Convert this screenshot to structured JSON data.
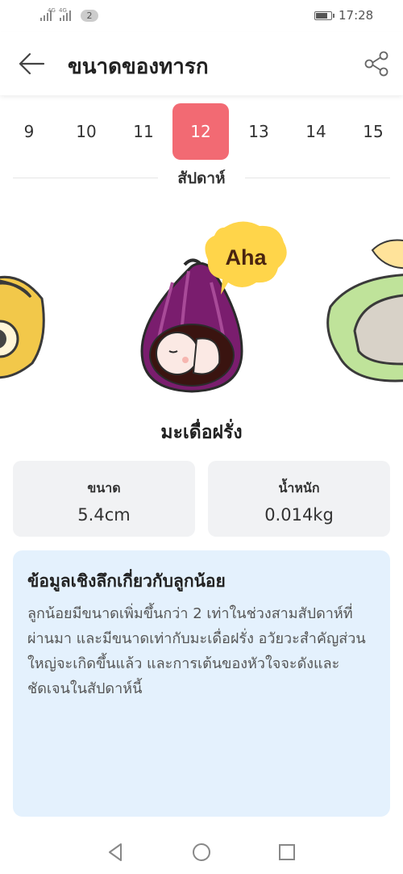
{
  "status_bar": {
    "time": "17:28",
    "sim_badge": "2",
    "net_tag_1": "4G",
    "net_tag_2": "4G",
    "battery_level": 0.8
  },
  "header": {
    "title": "ขนาดของทารก",
    "back_icon": "arrow-left-icon",
    "share_icon": "share-icon"
  },
  "weeks": {
    "items": [
      "9",
      "10",
      "11",
      "12",
      "13",
      "14",
      "15"
    ],
    "selected": "12",
    "label": "สัปดาห์"
  },
  "fruit": {
    "name": "มะเดื่อฝรั่ง",
    "bubble_text": "Aha"
  },
  "stats": {
    "size_label": "ขนาด",
    "size_value": "5.4cm",
    "weight_label": "น้ำหนัก",
    "weight_value": "0.014kg"
  },
  "insight": {
    "title": "ข้อมูลเชิงลึกเกี่ยวกับลูกน้อย",
    "body": "ลูกน้อยมีขนาดเพิ่มขึ้นกว่า 2 เท่าในช่วงสามสัปดาห์ที่ผ่านมา และมีขนาดเท่ากับมะเดื่อฝรั่ง อวัยวะสำคัญส่วนใหญ่จะเกิดขึ้นแล้ว และการเต้นของหัวใจจะดังและชัดเจนในสัปดาห์นี้"
  },
  "colors": {
    "accent": "#f26a73",
    "fig_purple": "#7a1d6e",
    "bubble_yellow": "#ffd54a",
    "card_bg": "#f1f2f4",
    "insight_bg": "#e4f1fd"
  },
  "nav_bar": {
    "icons": [
      "nav-back-icon",
      "nav-home-icon",
      "nav-recents-icon"
    ]
  }
}
